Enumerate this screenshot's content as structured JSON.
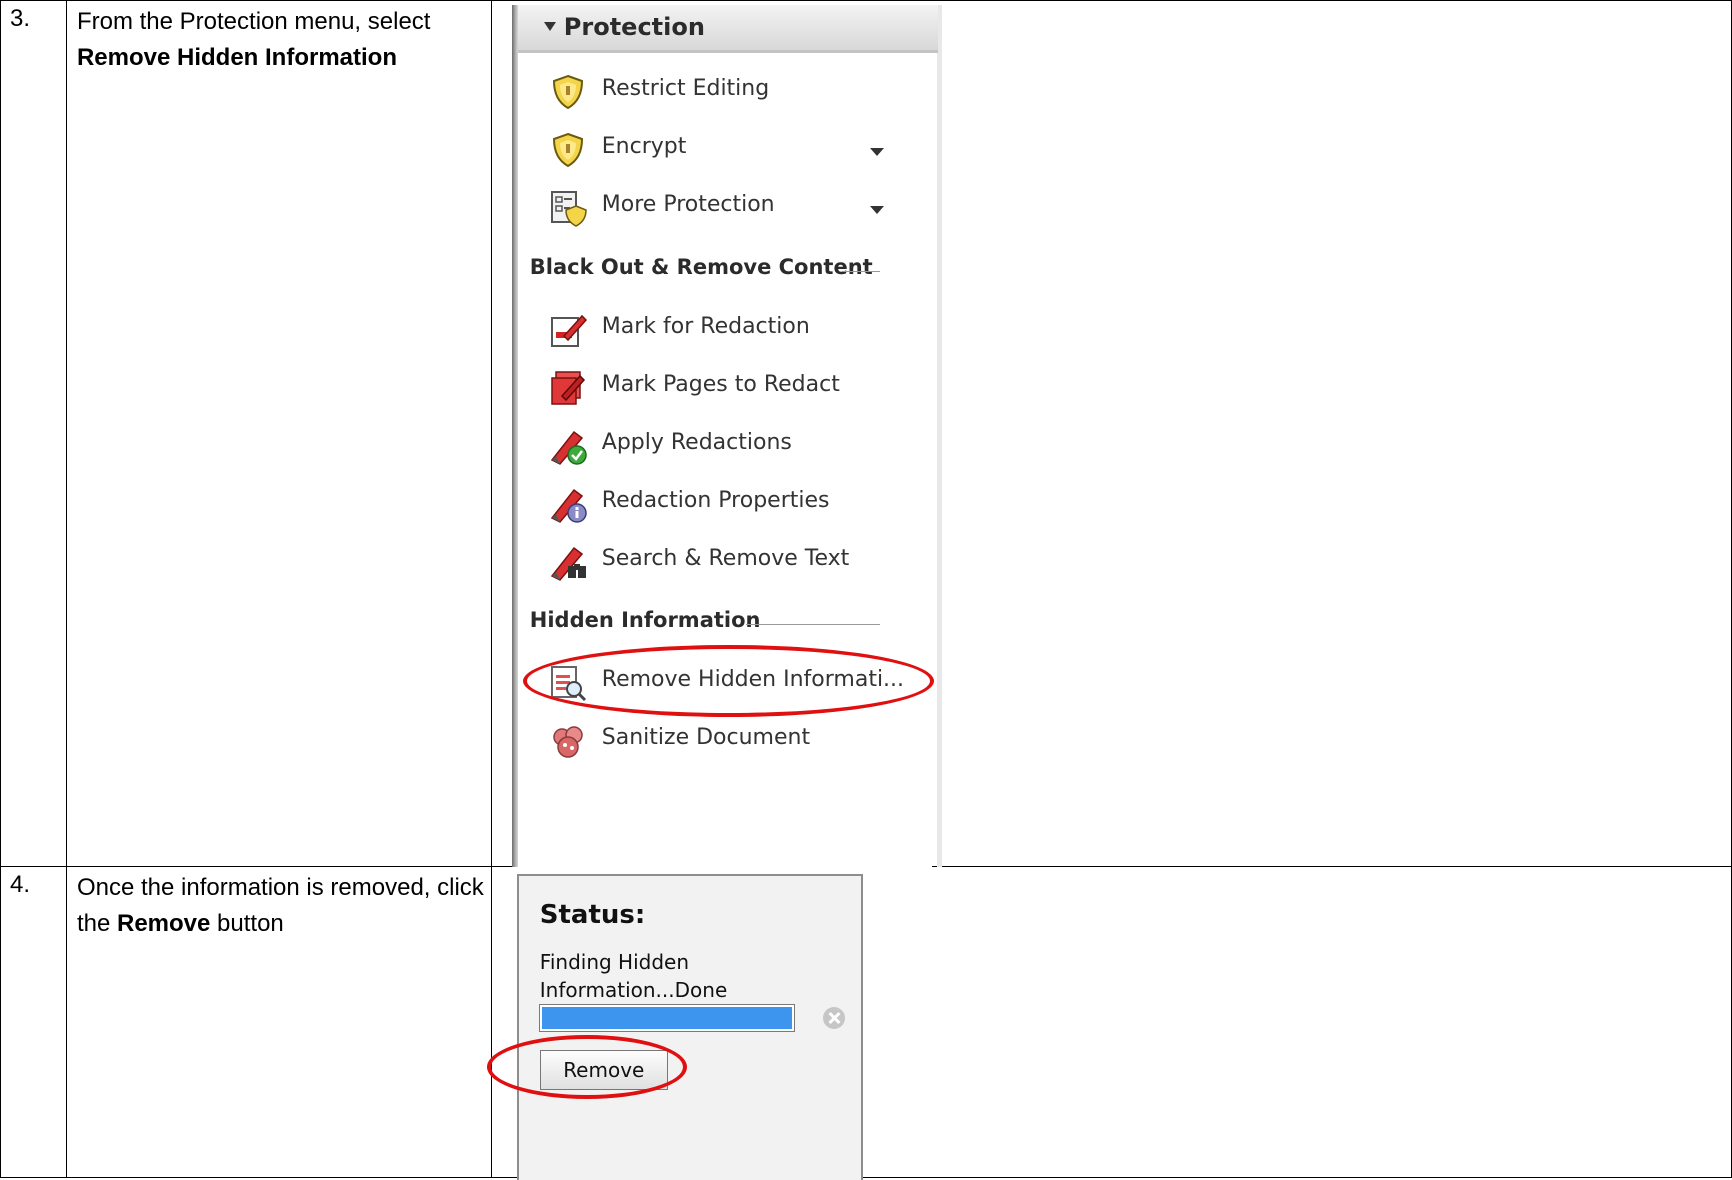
{
  "steps": [
    {
      "number": "3.",
      "text_before": "From the Protection menu, select ",
      "bold": "Remove Hidden Information",
      "text_after": ""
    },
    {
      "number": "4.",
      "text_before": "Once the information is removed, click the ",
      "bold": "Remove",
      "text_after": " button"
    }
  ],
  "protection_panel": {
    "title": "Protection",
    "items": [
      {
        "label": "Restrict Editing",
        "icon": "shield-icon"
      },
      {
        "label": "Encrypt",
        "icon": "shield-icon",
        "has_dropdown": true
      },
      {
        "label": "More Protection",
        "icon": "certificate-shield-icon",
        "has_dropdown": true
      }
    ],
    "section_redact": {
      "title": "Black Out & Remove Content",
      "items": [
        {
          "label": "Mark for Redaction",
          "icon": "redaction-marker-icon"
        },
        {
          "label": "Mark Pages to Redact",
          "icon": "redaction-pages-icon"
        },
        {
          "label": "Apply Redactions",
          "icon": "apply-redactions-icon"
        },
        {
          "label": "Redaction Properties",
          "icon": "redaction-properties-icon"
        },
        {
          "label": "Search & Remove Text",
          "icon": "search-remove-text-icon"
        }
      ]
    },
    "section_hidden": {
      "title": "Hidden Information",
      "items": [
        {
          "label": "Remove Hidden Informati...",
          "icon": "remove-hidden-info-icon"
        },
        {
          "label": "Sanitize Document",
          "icon": "sanitize-document-icon"
        }
      ]
    }
  },
  "status_panel": {
    "title": "Status:",
    "message": "Finding Hidden Information...Done",
    "progress": 1.0,
    "remove_button": "Remove"
  },
  "colors": {
    "highlight_circle": "#e01010",
    "progress_fill": "#3d95ee"
  }
}
